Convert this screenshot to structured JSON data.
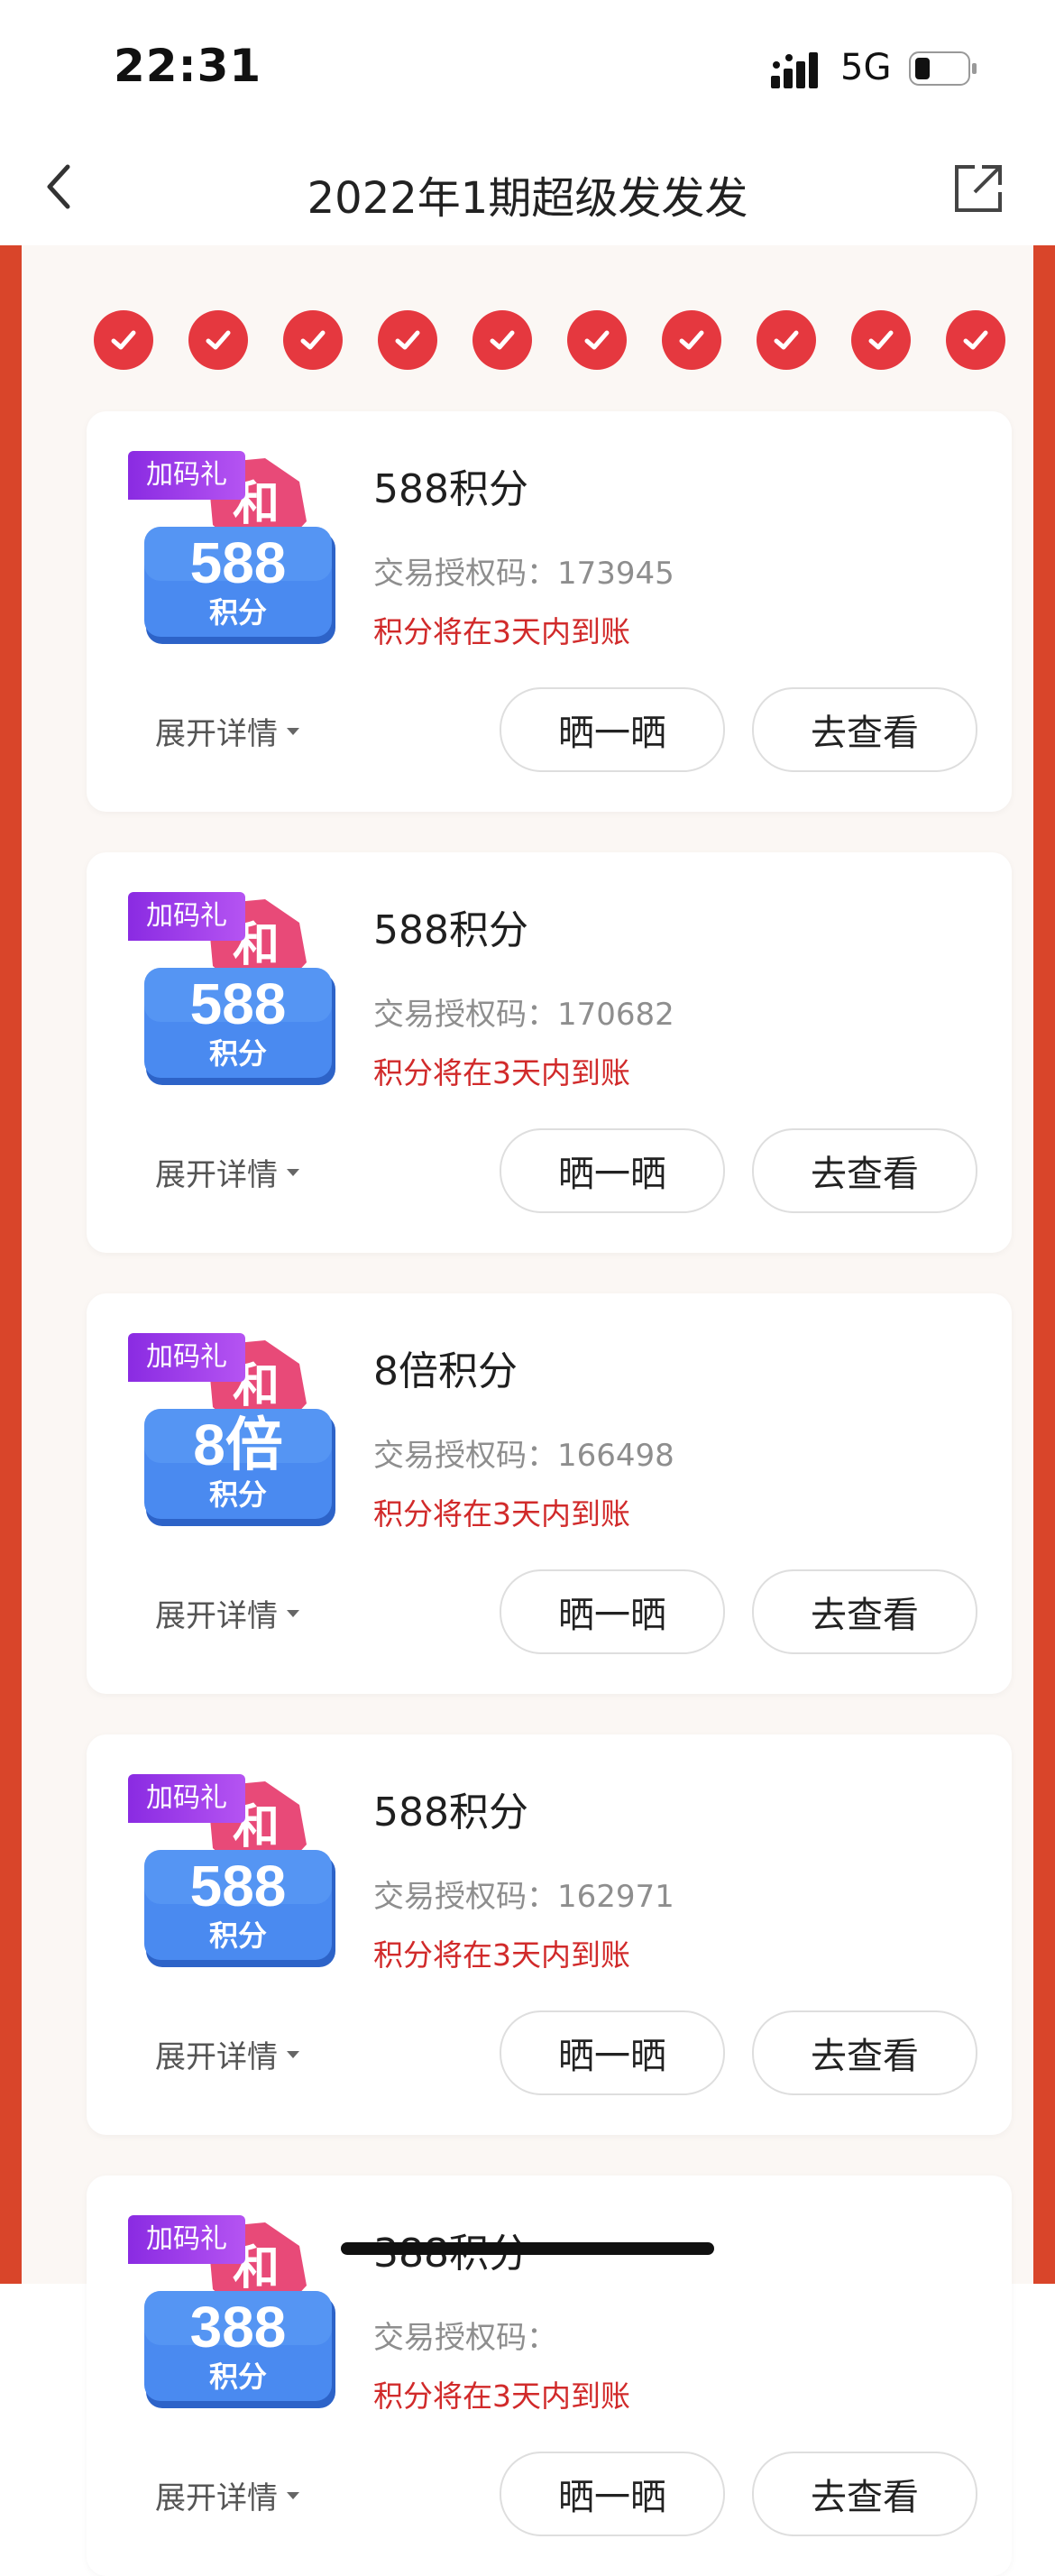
{
  "status_bar": {
    "time": "22:31",
    "network": "5G"
  },
  "nav": {
    "title": "2022年1期超级发发发"
  },
  "checkins": {
    "count": 10
  },
  "cards": [
    {
      "tag": "加码礼",
      "badge_value": "588",
      "badge_unit": "积分",
      "title": "588积分",
      "auth_label": "交易授权码：",
      "auth_code": "173945",
      "arrival_note": "积分将在3天内到账",
      "expand_label": "展开详情",
      "share_label": "晒一晒",
      "view_label": "去查看"
    },
    {
      "tag": "加码礼",
      "badge_value": "588",
      "badge_unit": "积分",
      "title": "588积分",
      "auth_label": "交易授权码：",
      "auth_code": "170682",
      "arrival_note": "积分将在3天内到账",
      "expand_label": "展开详情",
      "share_label": "晒一晒",
      "view_label": "去查看"
    },
    {
      "tag": "加码礼",
      "badge_value": "8倍",
      "badge_unit": "积分",
      "title": "8倍积分",
      "auth_label": "交易授权码：",
      "auth_code": "166498",
      "arrival_note": "积分将在3天内到账",
      "expand_label": "展开详情",
      "share_label": "晒一晒",
      "view_label": "去查看"
    },
    {
      "tag": "加码礼",
      "badge_value": "588",
      "badge_unit": "积分",
      "title": "588积分",
      "auth_label": "交易授权码：",
      "auth_code": "162971",
      "arrival_note": "积分将在3天内到账",
      "expand_label": "展开详情",
      "share_label": "晒一晒",
      "view_label": "去查看"
    },
    {
      "tag": "加码礼",
      "badge_value": "388",
      "badge_unit": "积分",
      "title": "388积分",
      "auth_label": "交易授权码：",
      "auth_code": "",
      "arrival_note": "积分将在3天内到账",
      "expand_label": "展开详情",
      "share_label": "晒一晒",
      "view_label": "去查看"
    }
  ],
  "badge_sticker": "和",
  "colors": {
    "accent_red": "#d9452a",
    "check_red": "#e5383f",
    "arrival_red": "#d12a2a",
    "tag_purple": "#8a2be2",
    "badge_blue": "#3f7fe6",
    "badge_pink": "#e84a78"
  },
  "icons": {
    "back": "chevron-left-icon",
    "share": "external-share-icon",
    "check": "check-icon"
  }
}
